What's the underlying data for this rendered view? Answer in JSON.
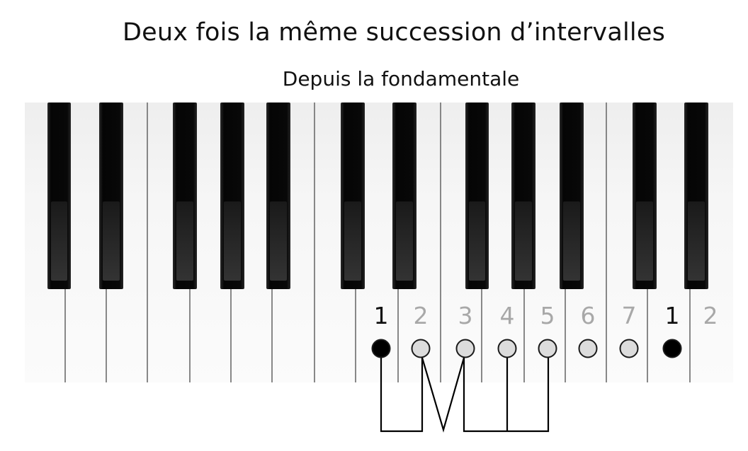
{
  "title": "Deux fois la même succession d’intervalles",
  "subtitle": "Depuis la fondamentale",
  "degrees": [
    {
      "label": "1",
      "highlight": true
    },
    {
      "label": "2",
      "highlight": false
    },
    {
      "label": "3",
      "highlight": false
    },
    {
      "label": "4",
      "highlight": false
    },
    {
      "label": "5",
      "highlight": false
    },
    {
      "label": "6",
      "highlight": false
    },
    {
      "label": "7",
      "highlight": false
    },
    {
      "label": "1",
      "highlight": true
    },
    {
      "label": "2",
      "highlight": false
    }
  ],
  "colors": {
    "highlight_label": "#111111",
    "dim_label": "#a8a8a8",
    "dot_filled": "#000000",
    "dot_empty": "#dcdcdc",
    "key_white": "#f7f7f7",
    "key_black": "#0d0d0d",
    "connector": "#000000"
  }
}
